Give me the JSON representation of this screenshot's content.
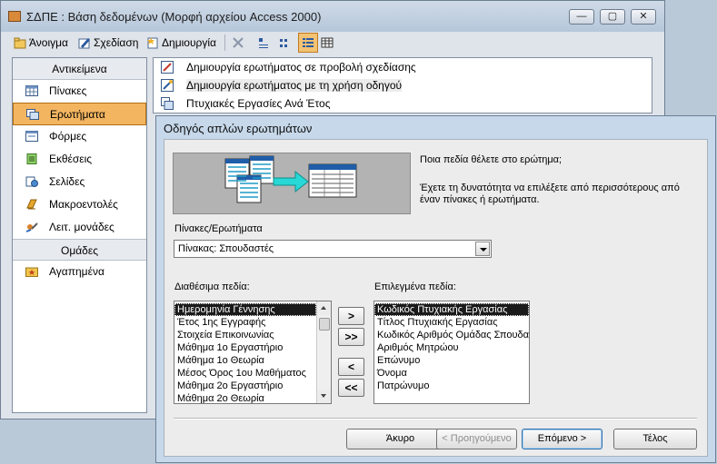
{
  "app": {
    "title": "ΣΔΠΕ : Βάση δεδομένων (Μορφή αρχείου Access 2000)",
    "window_buttons": {
      "minimize": "—",
      "maximize": "▢",
      "close": "✕"
    }
  },
  "toolbar": {
    "open": "Άνοιγμα",
    "design": "Σχεδίαση",
    "create": "Δημιουργία"
  },
  "objects_panel": {
    "header": "Αντικείμενα",
    "items": [
      {
        "label": "Πίνακες",
        "icon": "table-icon"
      },
      {
        "label": "Ερωτήματα",
        "icon": "query-icon",
        "selected": true
      },
      {
        "label": "Φόρμες",
        "icon": "form-icon"
      },
      {
        "label": "Εκθέσεις",
        "icon": "report-icon"
      },
      {
        "label": "Σελίδες",
        "icon": "page-icon"
      },
      {
        "label": "Μακροεντολές",
        "icon": "macro-icon"
      },
      {
        "label": "Λειτ. μονάδες",
        "icon": "module-icon"
      }
    ],
    "groups_header": "Ομάδες",
    "groups": [
      {
        "label": "Αγαπημένα",
        "icon": "favorites-icon"
      }
    ]
  },
  "object_list": [
    {
      "label": "Δημιουργία ερωτήματος σε προβολή σχεδίασης"
    },
    {
      "label": "Δημιουργία ερωτήματος με τη χρήση οδηγού"
    },
    {
      "label": "Πτυχιακές Εργασίες Ανά Έτος"
    }
  ],
  "wizard": {
    "title": "Οδηγός απλών ερωτημάτων",
    "instruction_1": "Ποια πεδία θέλετε στο ερώτημα;",
    "instruction_2": "Έχετε τη δυνατότητα να επιλέξετε από περισσότερους από έναν πίνακες ή ερωτήματα.",
    "tables_label": "Πίνακες/Ερωτήματα",
    "tables_value": "Πίνακας: Σπουδαστές",
    "available_label": "Διαθέσιμα πεδία:",
    "available_fields": [
      "Ημερομηνία Γέννησης",
      "Έτος 1ης Εγγραφής",
      "Στοιχεία Επικοινωνίας",
      "Μάθημα 1ο Εργαστήριο",
      "Μάθημα 1ο Θεωρία",
      "Μέσος Όρος 1ου Μαθήματος",
      "Μάθημα 2ο Εργαστήριο",
      "Μάθημα 2ο Θεωρία"
    ],
    "selected_label": "Επιλεγμένα πεδία:",
    "selected_fields": [
      "Κωδικός Πτυχιακής Εργασίας",
      "Τίτλος Πτυχιακής Εργασίας",
      "Κωδικός Αριθμός Ομάδας Σπουδασ",
      "Αριθμός Μητρώου",
      "Επώνυμο",
      "Όνομα",
      "Πατρώνυμο"
    ],
    "move_buttons": {
      "add_one": ">",
      "add_all": ">>",
      "remove_one": "<",
      "remove_all": "<<"
    },
    "buttons": {
      "cancel": "Άκυρο",
      "back": "< Προηγούμενο",
      "next": "Επόμενο >",
      "finish": "Τέλος"
    }
  }
}
